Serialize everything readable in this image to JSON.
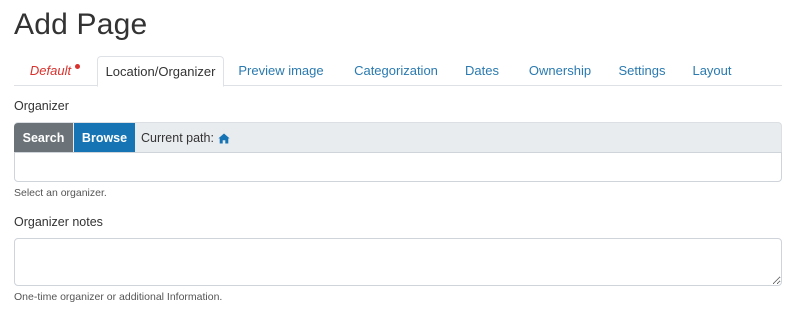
{
  "page": {
    "title": "Add Page"
  },
  "tabs": [
    {
      "label": "Default",
      "required": true
    },
    {
      "label": "Location/Organizer",
      "active": true
    },
    {
      "label": "Preview image"
    },
    {
      "label": "Categorization"
    },
    {
      "label": "Dates"
    },
    {
      "label": "Ownership"
    },
    {
      "label": "Settings"
    },
    {
      "label": "Layout"
    }
  ],
  "organizer": {
    "label": "Organizer",
    "search_button": "Search",
    "browse_button": "Browse",
    "current_path_label": "Current path:",
    "current_path_icon": "home-icon",
    "value": "",
    "help": "Select an organizer."
  },
  "notes": {
    "label": "Organizer notes",
    "value": "",
    "help": "One-time organizer or additional Information."
  },
  "colors": {
    "link": "#2a7ab0",
    "required": "#d9322e",
    "search_button": "#6b7378",
    "browse_button": "#1674b5",
    "picker_bar": "#e9ecef"
  }
}
